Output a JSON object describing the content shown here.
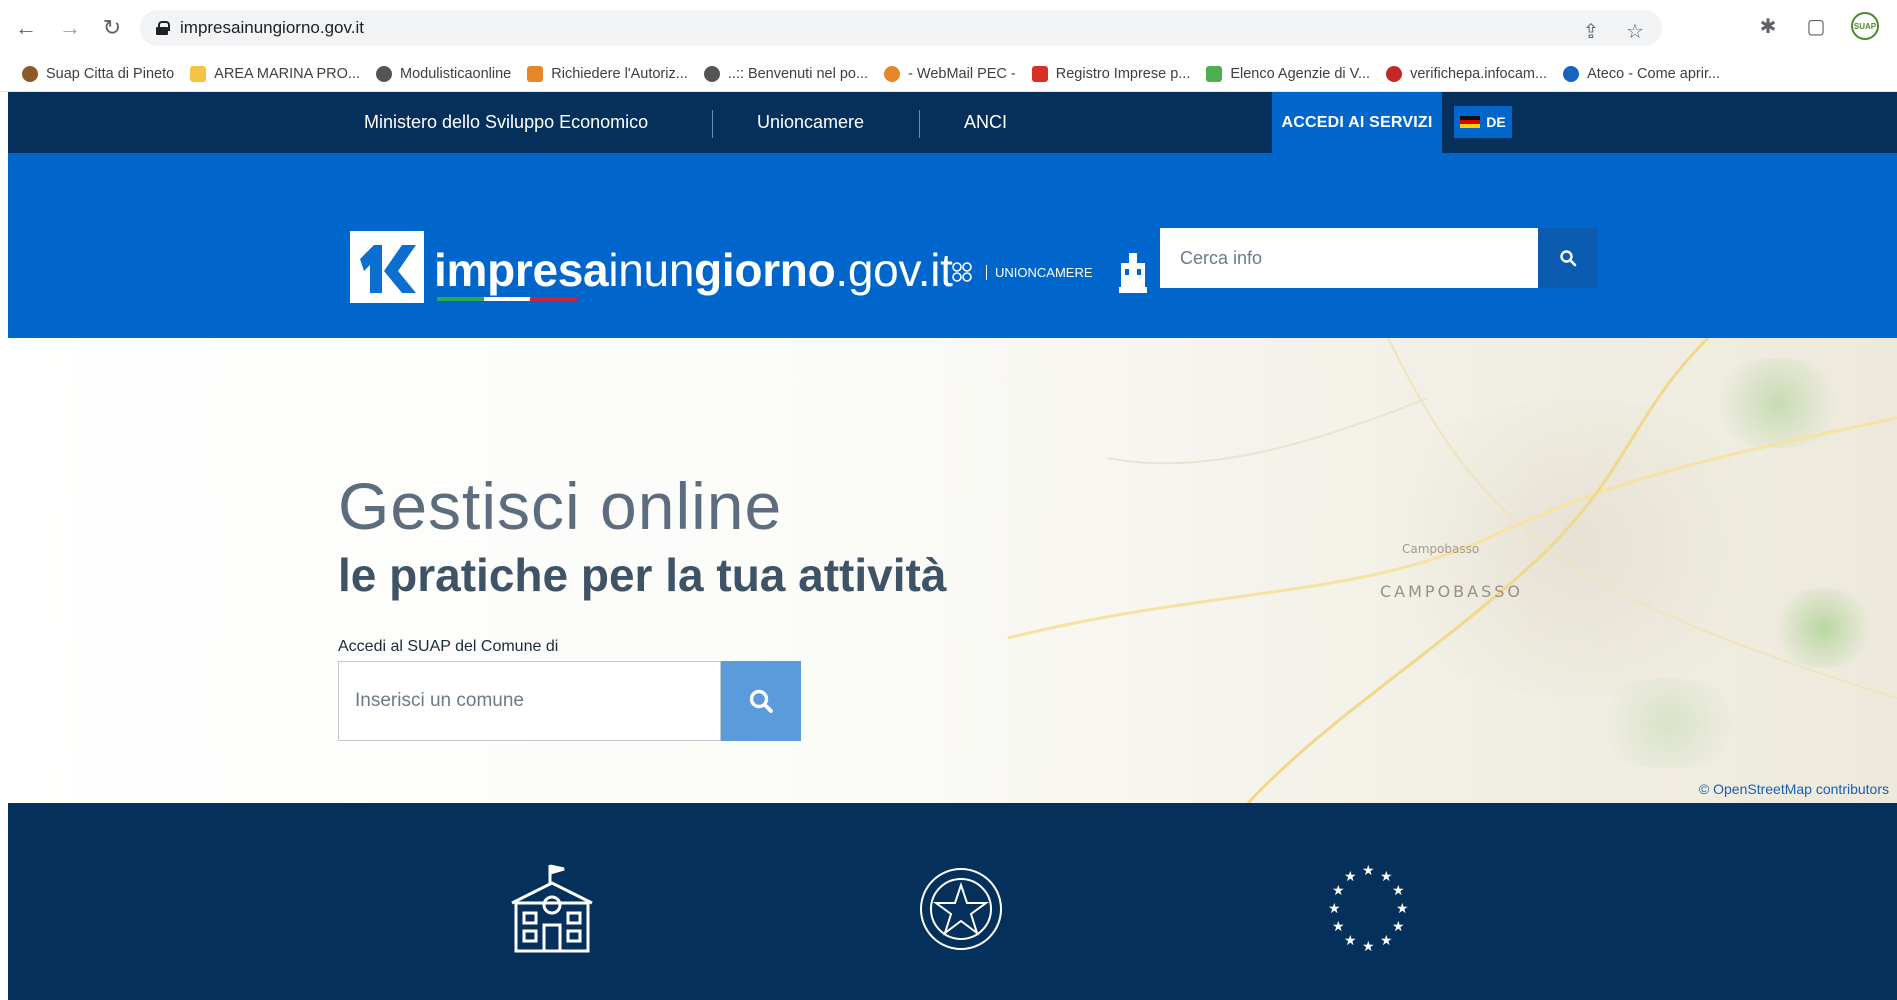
{
  "browser": {
    "url": "impresainungiorno.gov.it",
    "bookmarks": [
      {
        "label": "Suap Citta di Pineto",
        "color": "#8a5a2b"
      },
      {
        "label": "AREA MARINA PRO...",
        "color": "#f4c542"
      },
      {
        "label": "Modulisticaonline",
        "color": "#555555"
      },
      {
        "label": "Richiedere l'Autoriz...",
        "color": "#e8862a"
      },
      {
        "label": "..:: Benvenuti nel po...",
        "color": "#555555"
      },
      {
        "label": "- WebMail PEC -",
        "color": "#e8862a"
      },
      {
        "label": "Registro Imprese p...",
        "color": "#d93025"
      },
      {
        "label": "Elenco Agenzie di V...",
        "color": "#4caf50"
      },
      {
        "label": "verifichepa.infocam...",
        "color": "#c62828"
      },
      {
        "label": "Ateco - Come aprir...",
        "color": "#1565c0"
      }
    ],
    "profile_badge": "SUAP"
  },
  "topnav": {
    "links": [
      "Ministero dello Sviluppo Economico",
      "Unioncamere",
      "ANCI"
    ],
    "accedi": "ACCEDI AI SERVIZI",
    "lang": "DE"
  },
  "header": {
    "logo_bold1": "impresa",
    "logo_thin1": "inun",
    "logo_bold2": "giorno",
    "logo_thin2": ".gov.it",
    "unioncamere": "UNIONCAMERE",
    "search_placeholder": "Cerca info"
  },
  "hero": {
    "title_line1": "Gestisci online",
    "title_line2": "le pratiche per la tua attività",
    "label": "Accedi al SUAP del Comune di",
    "input_placeholder": "Inserisci un comune",
    "map_label_city": "CAMPOBASSO",
    "map_label_small": "Campobasso",
    "map_credit": "© OpenStreetMap contributors"
  },
  "colors": {
    "topnav_bg": "#06305c",
    "header_bg": "#0066cc",
    "accent_btn": "#5a9bdc"
  }
}
